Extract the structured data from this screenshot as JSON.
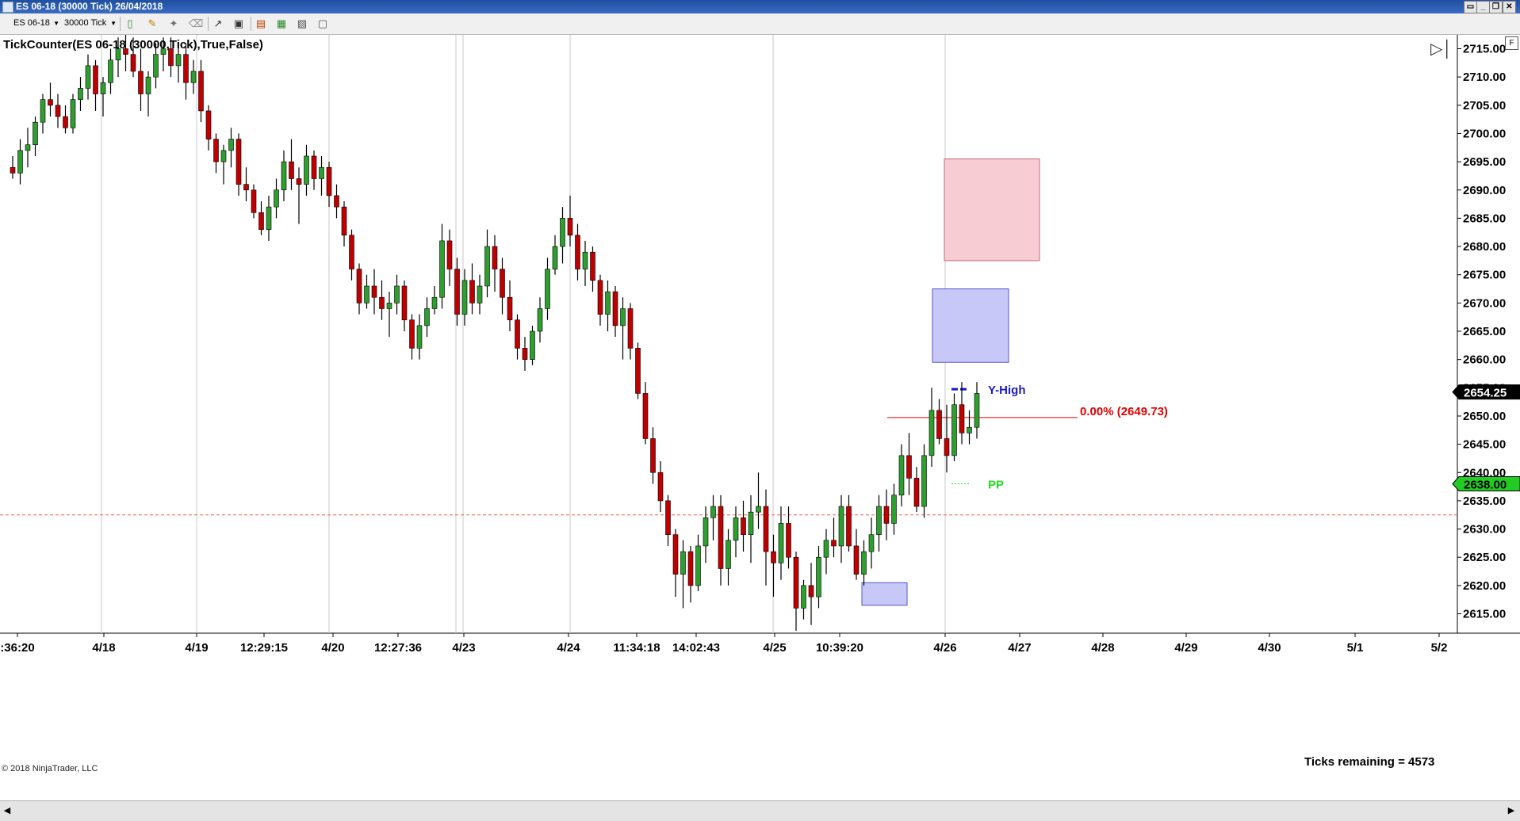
{
  "window": {
    "title": "ES 06-18 (30000 Tick)  26/04/2018",
    "buttons": [
      "▭",
      "_",
      "❐",
      "✕"
    ]
  },
  "toolbar": {
    "instrument": "ES 06-18",
    "interval": "30000 Tick",
    "icons": [
      "bars-style-icon",
      "drawing-tool-icon",
      "pin-icon",
      "eraser-icon",
      "cursor-icon",
      "zoom-icon",
      "indicators-icon",
      "strategies-icon",
      "properties-icon",
      "data-box-icon"
    ]
  },
  "chart": {
    "indicator_label": "TickCounter(ES 06-18 (30000,Tick),True,False)",
    "copyright": "© 2018 NinjaTrader, LLC",
    "ticks_remaining": "Ticks remaining = 4573",
    "right_tab": "F",
    "colors": {
      "up_candle": "#2e9e2e",
      "down_candle": "#c00000",
      "wick": "#000000",
      "red_zone": "#f7ccd3",
      "blue_zone": "#c8c8f8",
      "fib_line": "#e00000",
      "dashed_level": "#f06040",
      "y_high": "#1a1acc",
      "pp": "#22dd22",
      "price_badge": "#000000",
      "pp_badge": "#22cc22"
    }
  },
  "chart_data": {
    "type": "candlestick",
    "instrument": "ES 06-18",
    "yaxis": {
      "range": [
        2611.5,
        2718.5
      ],
      "ticks": [
        "2715.00",
        "2710.00",
        "2705.00",
        "2700.00",
        "2695.00",
        "2690.00",
        "2685.00",
        "2680.00",
        "2675.00",
        "2670.00",
        "2665.00",
        "2660.00",
        "2655.00",
        "2650.00",
        "2645.00",
        "2640.00",
        "2635.00",
        "2630.00",
        "2625.00",
        "2620.00",
        "2615.00"
      ]
    },
    "xaxis": {
      "labels": [
        ":36:20",
        "4/18",
        "4/19",
        "12:29:15",
        "4/20",
        "12:27:36",
        "4/23",
        "4/24",
        "11:34:18",
        "14:02:43",
        "4/25",
        "10:39:20",
        "4/26",
        "4/27",
        "4/28",
        "4/29",
        "4/30",
        "5/1",
        "5/2"
      ]
    },
    "candles": [
      [
        2694,
        2696,
        2692,
        2693
      ],
      [
        2693,
        2699,
        2691,
        2697
      ],
      [
        2697,
        2701,
        2694,
        2698
      ],
      [
        2698,
        2703,
        2696,
        2702
      ],
      [
        2702,
        2707,
        2700,
        2706
      ],
      [
        2706,
        2709,
        2703,
        2705
      ],
      [
        2705,
        2707,
        2701,
        2703
      ],
      [
        2703,
        2705,
        2700,
        2701
      ],
      [
        2701,
        2707,
        2700,
        2706
      ],
      [
        2706,
        2710,
        2704,
        2708
      ],
      [
        2708,
        2714,
        2706,
        2712
      ],
      [
        2712,
        2713,
        2704,
        2707
      ],
      [
        2707,
        2710,
        2703,
        2709
      ],
      [
        2709,
        2715,
        2707,
        2713
      ],
      [
        2713,
        2717,
        2710,
        2715
      ],
      [
        2715,
        2719,
        2711,
        2714
      ],
      [
        2714,
        2717,
        2710,
        2711
      ],
      [
        2711,
        2715,
        2704,
        2707
      ],
      [
        2707,
        2711,
        2703,
        2710
      ],
      [
        2710,
        2716,
        2708,
        2714
      ],
      [
        2714,
        2717,
        2711,
        2715
      ],
      [
        2715,
        2717,
        2710,
        2712
      ],
      [
        2712,
        2716,
        2709,
        2714
      ],
      [
        2714,
        2716,
        2706,
        2709
      ],
      [
        2709,
        2713,
        2707,
        2711
      ],
      [
        2711,
        2713,
        2702,
        2704
      ],
      [
        2704,
        2705,
        2697,
        2699
      ],
      [
        2699,
        2700,
        2693,
        2695
      ],
      [
        2695,
        2698,
        2691,
        2697
      ],
      [
        2697,
        2701,
        2694,
        2699
      ],
      [
        2699,
        2700,
        2689,
        2691
      ],
      [
        2691,
        2694,
        2688,
        2690
      ],
      [
        2690,
        2691,
        2685,
        2686
      ],
      [
        2686,
        2688,
        2682,
        2683
      ],
      [
        2683,
        2689,
        2681,
        2687
      ],
      [
        2687,
        2692,
        2685,
        2690
      ],
      [
        2690,
        2697,
        2688,
        2695
      ],
      [
        2695,
        2699,
        2690,
        2692
      ],
      [
        2692,
        2694,
        2684,
        2691
      ],
      [
        2691,
        2698,
        2689,
        2696
      ],
      [
        2696,
        2697,
        2690,
        2692
      ],
      [
        2692,
        2696,
        2689,
        2694
      ],
      [
        2694,
        2695,
        2687,
        2689
      ],
      [
        2689,
        2691,
        2685,
        2687
      ],
      [
        2687,
        2688,
        2680,
        2682
      ],
      [
        2682,
        2683,
        2674,
        2676
      ],
      [
        2676,
        2677,
        2668,
        2670
      ],
      [
        2670,
        2675,
        2669,
        2673
      ],
      [
        2673,
        2676,
        2668,
        2671
      ],
      [
        2671,
        2674,
        2667,
        2669
      ],
      [
        2669,
        2672,
        2664,
        2670
      ],
      [
        2670,
        2675,
        2668,
        2673
      ],
      [
        2673,
        2674,
        2665,
        2667
      ],
      [
        2667,
        2668,
        2660,
        2662
      ],
      [
        2662,
        2668,
        2660,
        2666
      ],
      [
        2666,
        2671,
        2664,
        2669
      ],
      [
        2669,
        2673,
        2668,
        2671
      ],
      [
        2671,
        2684,
        2669,
        2681
      ],
      [
        2681,
        2683,
        2673,
        2676
      ],
      [
        2676,
        2678,
        2666,
        2668
      ],
      [
        2668,
        2676,
        2666,
        2674
      ],
      [
        2674,
        2677,
        2668,
        2670
      ],
      [
        2670,
        2675,
        2668,
        2673
      ],
      [
        2673,
        2683,
        2671,
        2680
      ],
      [
        2680,
        2682,
        2672,
        2676
      ],
      [
        2676,
        2678,
        2668,
        2671
      ],
      [
        2671,
        2674,
        2665,
        2667
      ],
      [
        2667,
        2668,
        2660,
        2662
      ],
      [
        2662,
        2664,
        2658,
        2660
      ],
      [
        2660,
        2666,
        2659,
        2665
      ],
      [
        2665,
        2671,
        2663,
        2669
      ],
      [
        2669,
        2678,
        2667,
        2676
      ],
      [
        2676,
        2682,
        2675,
        2680
      ],
      [
        2680,
        2687,
        2677,
        2685
      ],
      [
        2685,
        2689,
        2680,
        2682
      ],
      [
        2682,
        2684,
        2674,
        2676
      ],
      [
        2676,
        2681,
        2673,
        2679
      ],
      [
        2679,
        2680,
        2672,
        2674
      ],
      [
        2674,
        2675,
        2666,
        2668
      ],
      [
        2668,
        2674,
        2665,
        2672
      ],
      [
        2672,
        2673,
        2664,
        2666
      ],
      [
        2666,
        2671,
        2660,
        2669
      ],
      [
        2669,
        2670,
        2660,
        2662
      ],
      [
        2662,
        2663,
        2653,
        2654
      ],
      [
        2654,
        2656,
        2645,
        2646
      ],
      [
        2646,
        2648,
        2638,
        2640
      ],
      [
        2640,
        2642,
        2633,
        2635
      ],
      [
        2635,
        2636,
        2627,
        2629
      ],
      [
        2629,
        2630,
        2618,
        2622
      ],
      [
        2622,
        2628,
        2616,
        2626
      ],
      [
        2626,
        2627,
        2617,
        2620
      ],
      [
        2620,
        2629,
        2619,
        2627
      ],
      [
        2627,
        2634,
        2624,
        2632
      ],
      [
        2632,
        2636,
        2628,
        2634
      ],
      [
        2634,
        2636,
        2620,
        2623
      ],
      [
        2623,
        2630,
        2620,
        2628
      ],
      [
        2628,
        2634,
        2625,
        2632
      ],
      [
        2632,
        2635,
        2626,
        2629
      ],
      [
        2629,
        2636,
        2624,
        2633
      ],
      [
        2633,
        2640,
        2630,
        2634
      ],
      [
        2634,
        2637,
        2620,
        2626
      ],
      [
        2626,
        2629,
        2618,
        2624
      ],
      [
        2624,
        2634,
        2621,
        2631
      ],
      [
        2631,
        2634,
        2623,
        2625
      ],
      [
        2625,
        2626,
        2612,
        2616
      ],
      [
        2616,
        2621,
        2614,
        2620
      ],
      [
        2620,
        2624,
        2613,
        2618
      ],
      [
        2618,
        2627,
        2616,
        2625
      ],
      [
        2625,
        2630,
        2622,
        2628
      ],
      [
        2628,
        2632,
        2625,
        2627
      ],
      [
        2627,
        2636,
        2624,
        2634
      ],
      [
        2634,
        2636,
        2626,
        2627
      ],
      [
        2627,
        2630,
        2621,
        2622
      ],
      [
        2622,
        2628,
        2620,
        2626
      ],
      [
        2626,
        2632,
        2623,
        2629
      ],
      [
        2629,
        2636,
        2626,
        2634
      ],
      [
        2634,
        2637,
        2628,
        2631
      ],
      [
        2631,
        2638,
        2629,
        2636
      ],
      [
        2636,
        2645,
        2634,
        2643
      ],
      [
        2643,
        2647,
        2636,
        2639
      ],
      [
        2639,
        2641,
        2633,
        2634
      ],
      [
        2634,
        2645,
        2632,
        2643
      ],
      [
        2643,
        2655,
        2641,
        2651
      ],
      [
        2651,
        2653,
        2645,
        2646
      ],
      [
        2646,
        2652,
        2640,
        2643
      ],
      [
        2643,
        2654,
        2642,
        2652
      ],
      [
        2652,
        2656,
        2645,
        2647
      ],
      [
        2647,
        2651,
        2645,
        2648
      ],
      [
        2648,
        2656,
        2646,
        2654
      ]
    ],
    "zones": [
      {
        "name": "supply-zone-red",
        "from": 2677.5,
        "to": 2695.5
      },
      {
        "name": "demand-zone-blue",
        "from": 2659.5,
        "to": 2672.5
      },
      {
        "name": "demand-zone-small",
        "from": 2616.5,
        "to": 2620.5
      }
    ],
    "levels": {
      "fib_label": "0.00% (2649.73)",
      "fib_value": 2649.73,
      "dashed_value": 2632.5,
      "y_high_label": "Y-High",
      "y_high_value": 2654.75,
      "pp_label": "PP",
      "pp_value": 2638.0
    },
    "price_badges": {
      "last": "2654.25",
      "pp": "2638.00"
    }
  }
}
